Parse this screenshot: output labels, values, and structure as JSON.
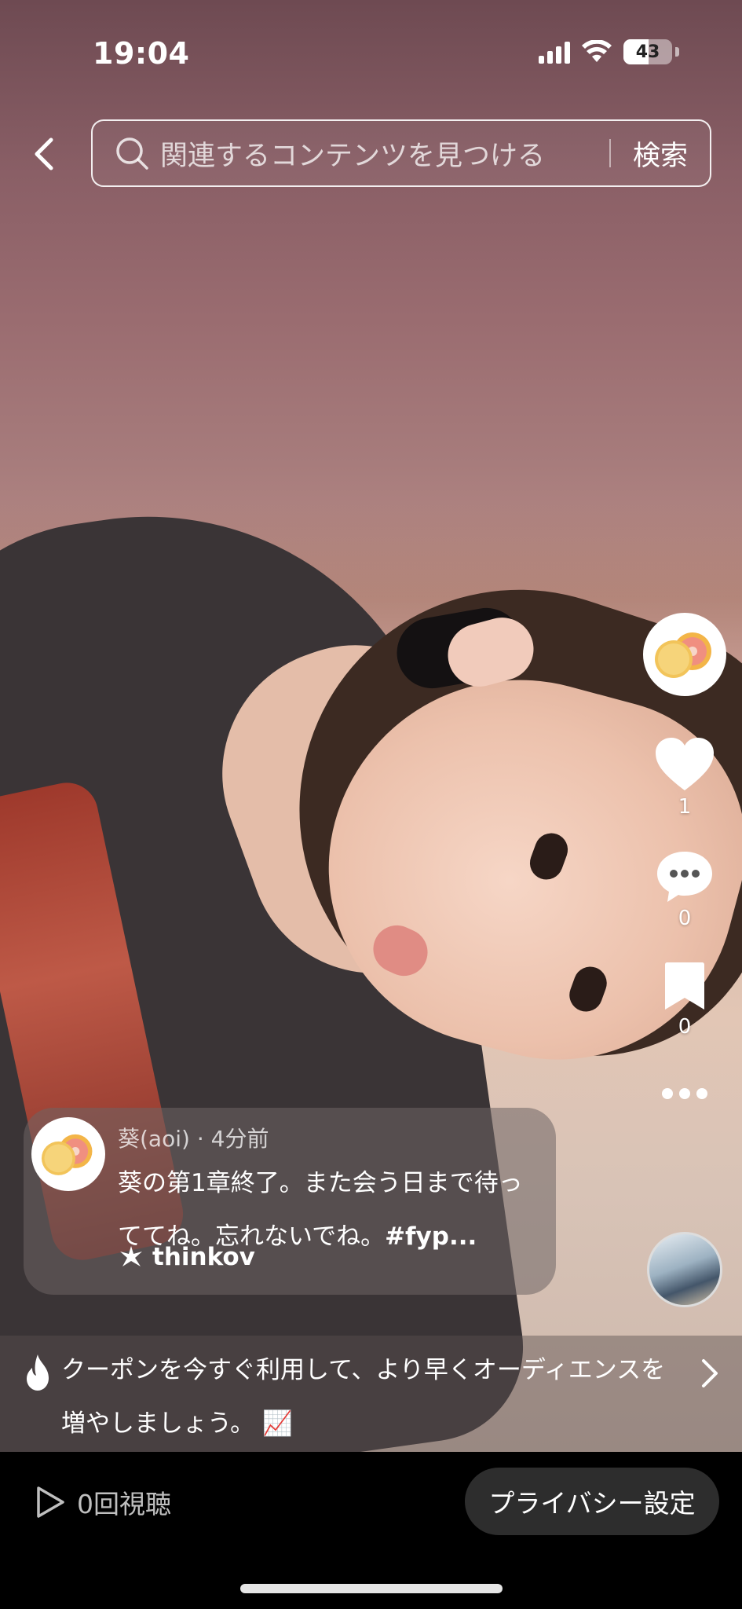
{
  "status_bar": {
    "time": "19:04",
    "battery_level": "43"
  },
  "search": {
    "placeholder": "関連するコンテンツを見つける",
    "submit_label": "検索"
  },
  "actions": {
    "like_count": "1",
    "comment_count": "0",
    "save_count": "0"
  },
  "post": {
    "author": "葵(aoi)",
    "separator": " · ",
    "time_ago": "4分前",
    "caption": "葵の第1章終了。また会う日まで待っててね。忘れないでね。",
    "hashtag": "#fyp...",
    "sound_name": "thinkov"
  },
  "promo": {
    "text": "クーポンを今すぐ利用して、より早くオーディエンスを増やしましょう。",
    "emoji": "📈"
  },
  "footer": {
    "views": "0回視聴",
    "privacy_label": "プライバシー設定"
  },
  "colors": {
    "like_white": "#ffffff",
    "bottom_bar": "#000000",
    "privacy_button": "#2d2d2d"
  }
}
